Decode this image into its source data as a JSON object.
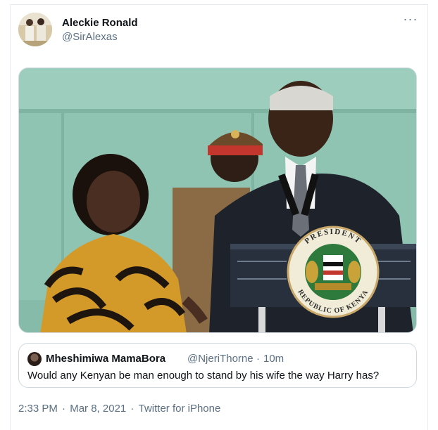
{
  "tweet": {
    "author": {
      "name": "Aleckie Ronald",
      "handle": "@SirAlexas",
      "avatar_icon": "user-avatar"
    },
    "more_icon": "more-horizontal-icon",
    "more_label": "···",
    "photo": {
      "seal_top_text": "PRESIDENT",
      "seal_bottom_text": "REPUBLIC OF KENYA"
    },
    "quoted": {
      "name": "Mheshimiwa MamaBora",
      "handle": "@NjeriThorne",
      "separator": "·",
      "time": "10m",
      "text": "Would any Kenyan be man enough to stand by his wife the way Harry has?"
    },
    "meta": {
      "time": "2:33 PM",
      "sep1": " · ",
      "date": "Mar 8, 2021",
      "sep2": " · ",
      "source": "Twitter for iPhone"
    }
  },
  "colors": {
    "text_primary": "#0f1419",
    "text_secondary": "#5b7083",
    "border": "#cfd9de"
  }
}
